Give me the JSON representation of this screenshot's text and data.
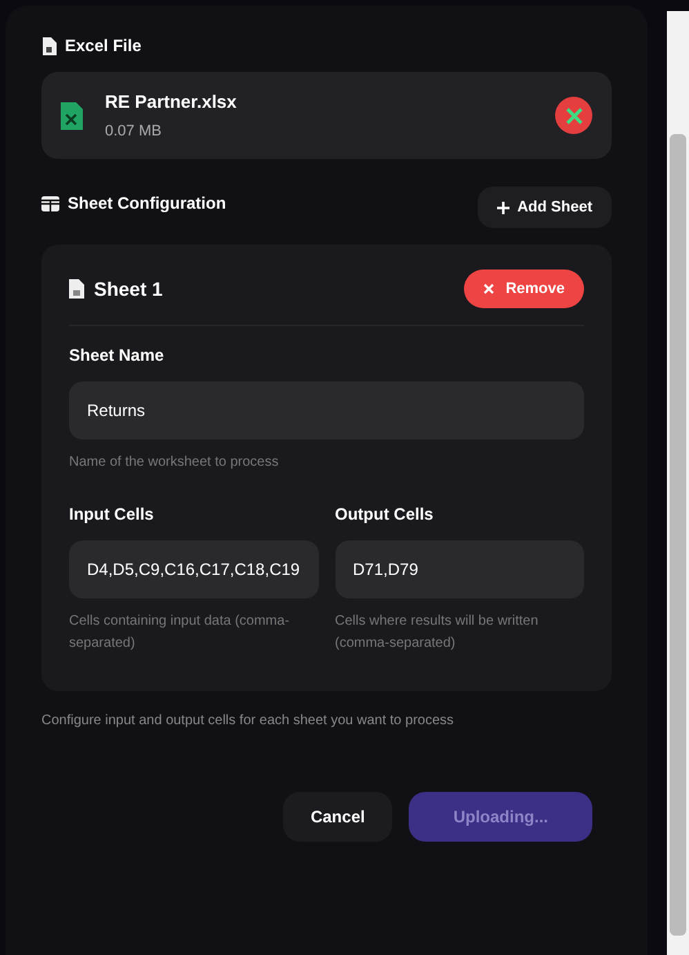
{
  "file_section": {
    "title": "Excel File",
    "file": {
      "name": "RE Partner.xlsx",
      "size": "0.07 MB"
    }
  },
  "sheet_section": {
    "title": "Sheet Configuration",
    "add_button": "Add Sheet",
    "sheets": [
      {
        "title": "Sheet 1",
        "remove_button": "Remove",
        "name_label": "Sheet Name",
        "name_value": "Returns",
        "name_hint": "Name of the worksheet to process",
        "input_label": "Input Cells",
        "input_value": "D4,D5,C9,C16,C17,C18,C19",
        "input_hint": "Cells containing input data (comma-separated)",
        "output_label": "Output Cells",
        "output_value": "D71,D79",
        "output_hint": "Cells where results will be written (comma-separated)"
      }
    ],
    "hint": "Configure input and output cells for each sheet you want to process"
  },
  "buttons": {
    "cancel": "Cancel",
    "submit": {
      "label": "Uploading...",
      "disabled": true
    }
  }
}
